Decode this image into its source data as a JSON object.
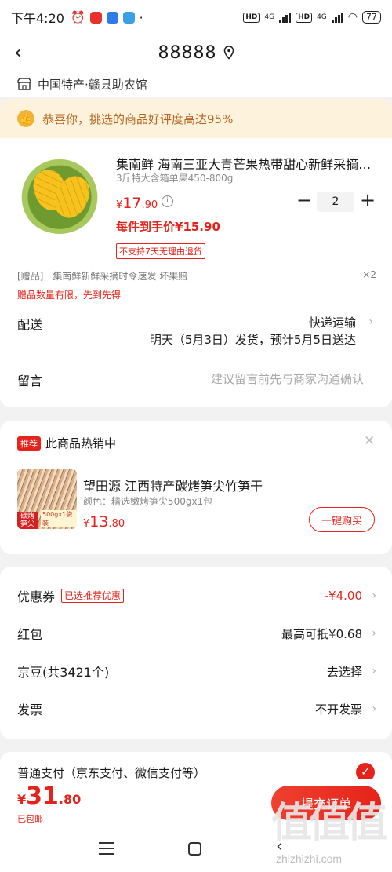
{
  "status_bar": {
    "time": "下午4:20",
    "network1": "4G",
    "network2": "4G",
    "battery": "77",
    "hd_label": "HD"
  },
  "header": {
    "address_title": "88888"
  },
  "shop": {
    "name": "中国特产·赣县助农馆"
  },
  "notice": {
    "text": "恭喜你，挑选的商品好评度高达95%"
  },
  "product": {
    "title": "集南鲜 海南三亚大青芒果热带甜心新鲜采摘…",
    "spec": "3斤特大含箱单果450-800g",
    "price_symbol": "¥",
    "price_int": "17",
    "price_dec": ".90",
    "quantity": "2",
    "final_price": "每件到手价¥15.90",
    "return_policy": "不支持7天无理由退货",
    "gift_tag": "[赠品]",
    "gift_name": "集南鲜新鲜采摘时令速发 坏果赔",
    "gift_qty": "×2",
    "gift_limit": "赠品数量有限，先到先得"
  },
  "delivery": {
    "label": "配送",
    "method": "快递运输",
    "date": "明天（5月3日）发货，预计5月5日送达"
  },
  "note": {
    "label": "留言",
    "placeholder": "建议留言前先与商家沟通确认"
  },
  "recommend": {
    "badge": "推荐",
    "title": "此商品热销中",
    "name": "望田源 江西特产碳烤笋尖竹笋干",
    "spec": "颜色：精选嫩烤笋尖500gx1包",
    "price_symbol": "¥",
    "price_int": "13",
    "price_dec": ".80",
    "buy_label": "一键购买",
    "img_tag": "碳烤笋尖",
    "img_tag2": "500gx1袋装"
  },
  "benefits": {
    "coupon_label": "优惠券",
    "coupon_tag": "已选推荐优惠",
    "coupon_value": "-¥4.00",
    "redpacket_label": "红包",
    "redpacket_value": "最高可抵¥0.68",
    "jingdou_label": "京豆(共3421个)",
    "jingdou_value": "去选择",
    "invoice_label": "发票",
    "invoice_value": "不开发票"
  },
  "payment": {
    "label": "普通支付（京东支付、微信支付等）"
  },
  "footer": {
    "total_symbol": "¥",
    "total_int": "31",
    "total_dec": ".80",
    "shipping": "已包邮",
    "submit": "提交订单"
  },
  "watermark": {
    "logo": "值值值",
    "url": "zhizhizhi.com"
  },
  "colors": {
    "accent": "#e5231a",
    "notice_bg": "#fdf3dd",
    "notice_text": "#b8651d"
  }
}
